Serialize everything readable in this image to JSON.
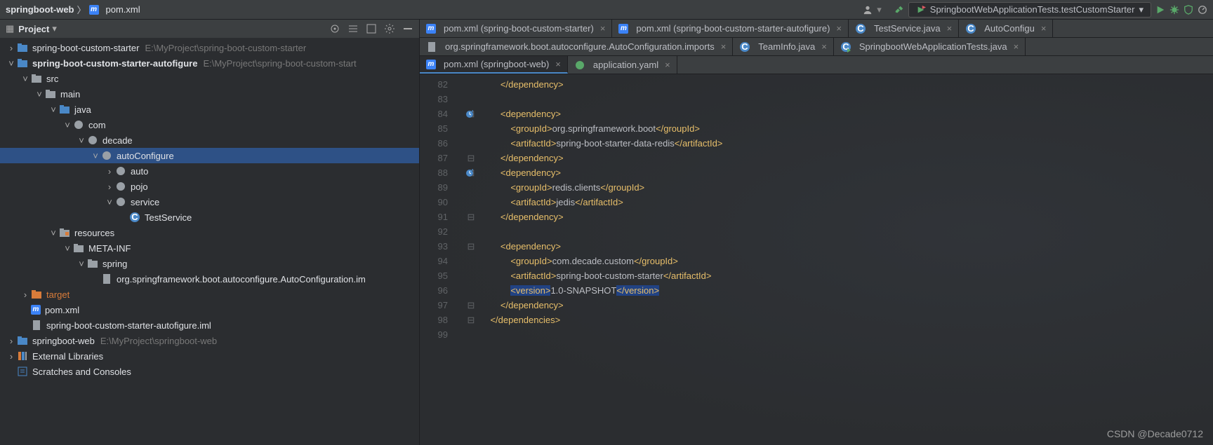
{
  "breadcrumb": {
    "root": "springboot-web",
    "file": "pom.xml"
  },
  "toolbar": {
    "user_icon": "user",
    "build_icon": "hammer",
    "run_config": "SpringbootWebApplicationTests.testCustomStarter",
    "actions": [
      "run",
      "debug",
      "coverage",
      "profile-stop"
    ]
  },
  "project_panel": {
    "title": "Project",
    "header_icons": [
      "select-open",
      "collapse",
      "expand-all",
      "settings",
      "hide"
    ]
  },
  "tree": [
    {
      "d": 0,
      "a": ">",
      "i": "module",
      "t": "spring-boot-custom-starter",
      "p": "E:\\MyProject\\spring-boot-custom-starter"
    },
    {
      "d": 0,
      "a": "v",
      "i": "module",
      "t": "spring-boot-custom-starter-autofigure",
      "p": "E:\\MyProject\\spring-boot-custom-start",
      "bold": true
    },
    {
      "d": 1,
      "a": "v",
      "i": "folder",
      "t": "src"
    },
    {
      "d": 2,
      "a": "v",
      "i": "folder",
      "t": "main"
    },
    {
      "d": 3,
      "a": "v",
      "i": "folder-blue",
      "t": "java"
    },
    {
      "d": 4,
      "a": "v",
      "i": "pkg",
      "t": "com"
    },
    {
      "d": 5,
      "a": "v",
      "i": "pkg",
      "t": "decade"
    },
    {
      "d": 6,
      "a": "v",
      "i": "pkg",
      "t": "autoConfigure",
      "sel": true
    },
    {
      "d": 7,
      "a": ">",
      "i": "pkg",
      "t": "auto"
    },
    {
      "d": 7,
      "a": ">",
      "i": "pkg",
      "t": "pojo"
    },
    {
      "d": 7,
      "a": "v",
      "i": "pkg",
      "t": "service"
    },
    {
      "d": 8,
      "a": "",
      "i": "class",
      "t": "TestService"
    },
    {
      "d": 3,
      "a": "v",
      "i": "folder-res",
      "t": "resources"
    },
    {
      "d": 4,
      "a": "v",
      "i": "folder",
      "t": "META-INF"
    },
    {
      "d": 5,
      "a": "v",
      "i": "folder",
      "t": "spring"
    },
    {
      "d": 6,
      "a": "",
      "i": "file",
      "t": "org.springframework.boot.autoconfigure.AutoConfiguration.im"
    },
    {
      "d": 1,
      "a": ">",
      "i": "folder-orange",
      "t": "target",
      "cls": "target"
    },
    {
      "d": 1,
      "a": "",
      "i": "maven",
      "t": "pom.xml"
    },
    {
      "d": 1,
      "a": "",
      "i": "file",
      "t": "spring-boot-custom-starter-autofigure.iml"
    },
    {
      "d": 0,
      "a": ">",
      "i": "module",
      "t": "springboot-web",
      "p": "E:\\MyProject\\springboot-web",
      "thin": true
    },
    {
      "d": 0,
      "a": ">",
      "i": "lib",
      "t": "External Libraries"
    },
    {
      "d": 0,
      "a": "",
      "i": "scratch",
      "t": "Scratches and Consoles"
    }
  ],
  "tabs_row1": [
    {
      "i": "maven",
      "t": "pom.xml (spring-boot-custom-starter)"
    },
    {
      "i": "maven",
      "t": "pom.xml (spring-boot-custom-starter-autofigure)"
    },
    {
      "i": "class",
      "t": "TestService.java"
    },
    {
      "i": "class",
      "t": "AutoConfigu"
    }
  ],
  "tabs_row2": [
    {
      "i": "file",
      "t": "org.springframework.boot.autoconfigure.AutoConfiguration.imports"
    },
    {
      "i": "class",
      "t": "TeamInfo.java"
    },
    {
      "i": "class-run",
      "t": "SpringbootWebApplicationTests.java"
    }
  ],
  "tabs_row3": [
    {
      "i": "maven",
      "t": "pom.xml (springboot-web)",
      "active": true
    },
    {
      "i": "spring",
      "t": "application.yaml"
    }
  ],
  "code": {
    "lines": [
      {
        "n": 82,
        "f": "",
        "html": "        <span class='tag'>&lt;/dependency&gt;</span>"
      },
      {
        "n": 83,
        "f": "",
        "html": ""
      },
      {
        "n": 84,
        "f": "-",
        "mark": "up",
        "html": "        <span class='tag'>&lt;dependency&gt;</span>"
      },
      {
        "n": 85,
        "f": "",
        "html": "            <span class='tag'>&lt;groupId&gt;</span>org.springframework.boot<span class='tag'>&lt;/groupId&gt;</span>"
      },
      {
        "n": 86,
        "f": "",
        "html": "            <span class='tag'>&lt;artifactId&gt;</span>spring-boot-starter-data-redis<span class='tag'>&lt;/artifactId&gt;</span>"
      },
      {
        "n": 87,
        "f": "-",
        "html": "        <span class='tag'>&lt;/dependency&gt;</span>"
      },
      {
        "n": 88,
        "f": "-",
        "mark": "up",
        "html": "        <span class='tag'>&lt;dependency&gt;</span>"
      },
      {
        "n": 89,
        "f": "",
        "html": "            <span class='tag'>&lt;groupId&gt;</span>redis.clients<span class='tag'>&lt;/groupId&gt;</span>"
      },
      {
        "n": 90,
        "f": "",
        "html": "            <span class='tag'>&lt;artifactId&gt;</span>jedis<span class='tag'>&lt;/artifactId&gt;</span>"
      },
      {
        "n": 91,
        "f": "-",
        "html": "        <span class='tag'>&lt;/dependency&gt;</span>"
      },
      {
        "n": 92,
        "f": "",
        "html": ""
      },
      {
        "n": 93,
        "f": "-",
        "html": "        <span class='tag'>&lt;dependency&gt;</span>"
      },
      {
        "n": 94,
        "f": "",
        "html": "            <span class='tag'>&lt;groupId&gt;</span>com.decade.custom<span class='tag'>&lt;/groupId&gt;</span>"
      },
      {
        "n": 95,
        "f": "",
        "html": "            <span class='tag'>&lt;artifactId&gt;</span>spring-boot-custom-starter<span class='tag'>&lt;/artifactId&gt;</span>"
      },
      {
        "n": 96,
        "f": "",
        "html": "            <span class='tag hl'>&lt;version&gt;</span>1.0-SNAPSHOT<span class='tag hl'>&lt;/version&gt;</span>"
      },
      {
        "n": 97,
        "f": "-",
        "html": "        <span class='tag'>&lt;/dependency&gt;</span>"
      },
      {
        "n": 98,
        "f": "-",
        "html": "    <span class='tag'>&lt;/dependencies&gt;</span>"
      },
      {
        "n": 99,
        "f": "",
        "html": ""
      }
    ]
  },
  "watermark": "CSDN @Decade0712"
}
